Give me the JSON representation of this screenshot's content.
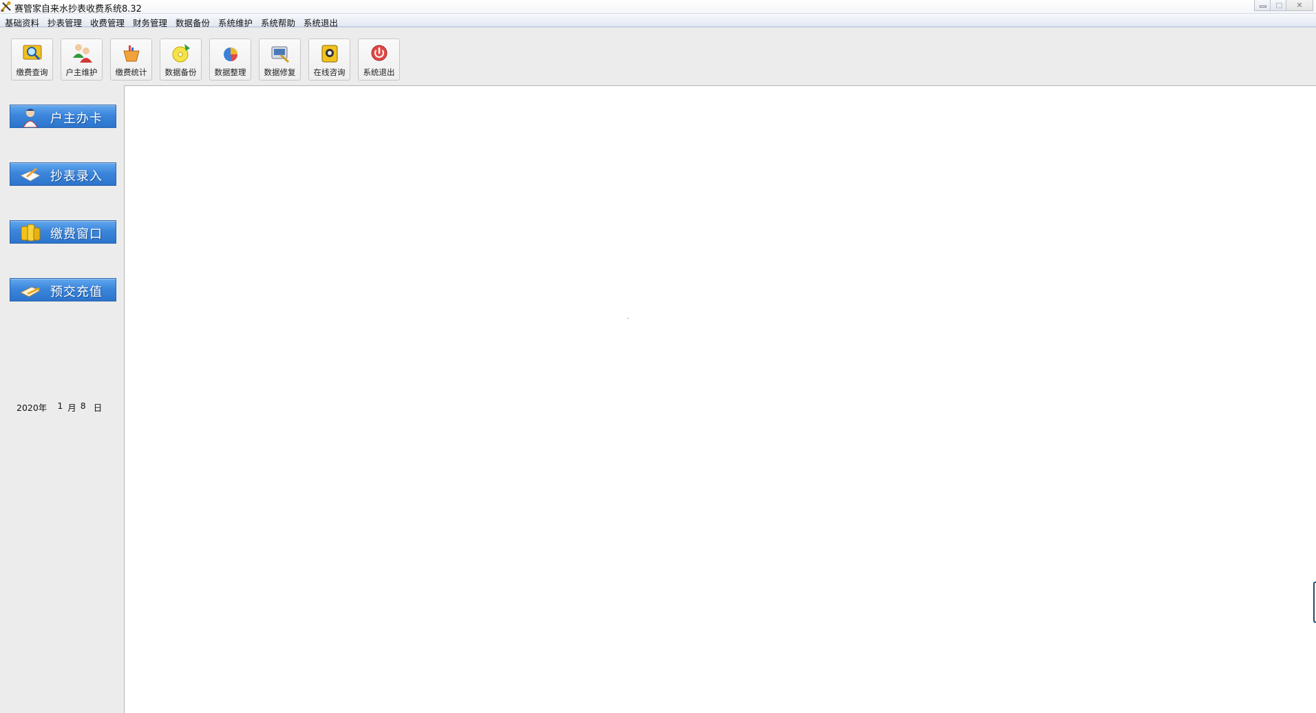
{
  "window": {
    "title": "赛管家自来水抄表收费系统8.32",
    "app_icon": "tools-icon",
    "controls": [
      "minimize-icon",
      "maximize-icon",
      "close-icon"
    ],
    "close_glyph": "✕"
  },
  "menu": [
    {
      "label": "基础资料"
    },
    {
      "label": "抄表管理"
    },
    {
      "label": "收费管理"
    },
    {
      "label": "财务管理"
    },
    {
      "label": "数据备份"
    },
    {
      "label": "系统维护"
    },
    {
      "label": "系统帮助"
    },
    {
      "label": "系统退出"
    }
  ],
  "toolbar": [
    {
      "label": "缴费查询",
      "icon": "search-magnifier-icon"
    },
    {
      "label": "户主维护",
      "icon": "users-icon"
    },
    {
      "label": "缴费统计",
      "icon": "basket-chart-icon"
    },
    {
      "label": "数据备份",
      "icon": "backup-disc-icon"
    },
    {
      "label": "数据整理",
      "icon": "pie-chart-icon"
    },
    {
      "label": "数据修复",
      "icon": "repair-tool-icon"
    },
    {
      "label": "在线咨询",
      "icon": "support-headset-icon"
    },
    {
      "label": "系统退出",
      "icon": "power-exit-icon"
    }
  ],
  "sidebar": {
    "buttons": [
      {
        "label": "户主办卡",
        "icon": "person-card-icon"
      },
      {
        "label": "抄表录入",
        "icon": "notebook-pen-icon"
      },
      {
        "label": "缴费窗口",
        "icon": "coins-icon"
      },
      {
        "label": "预交充值",
        "icon": "card-pen-icon"
      }
    ],
    "date": {
      "year": "2020年",
      "month": "1",
      "month_unit": "月",
      "day": "8",
      "day_unit": "日"
    }
  },
  "colors": {
    "nav_button": "#3b86dc",
    "menubar": "#e2e8f2",
    "panel_bg": "#ececec",
    "workspace_bg": "#ffffff",
    "exit_icon": "#e34848"
  }
}
